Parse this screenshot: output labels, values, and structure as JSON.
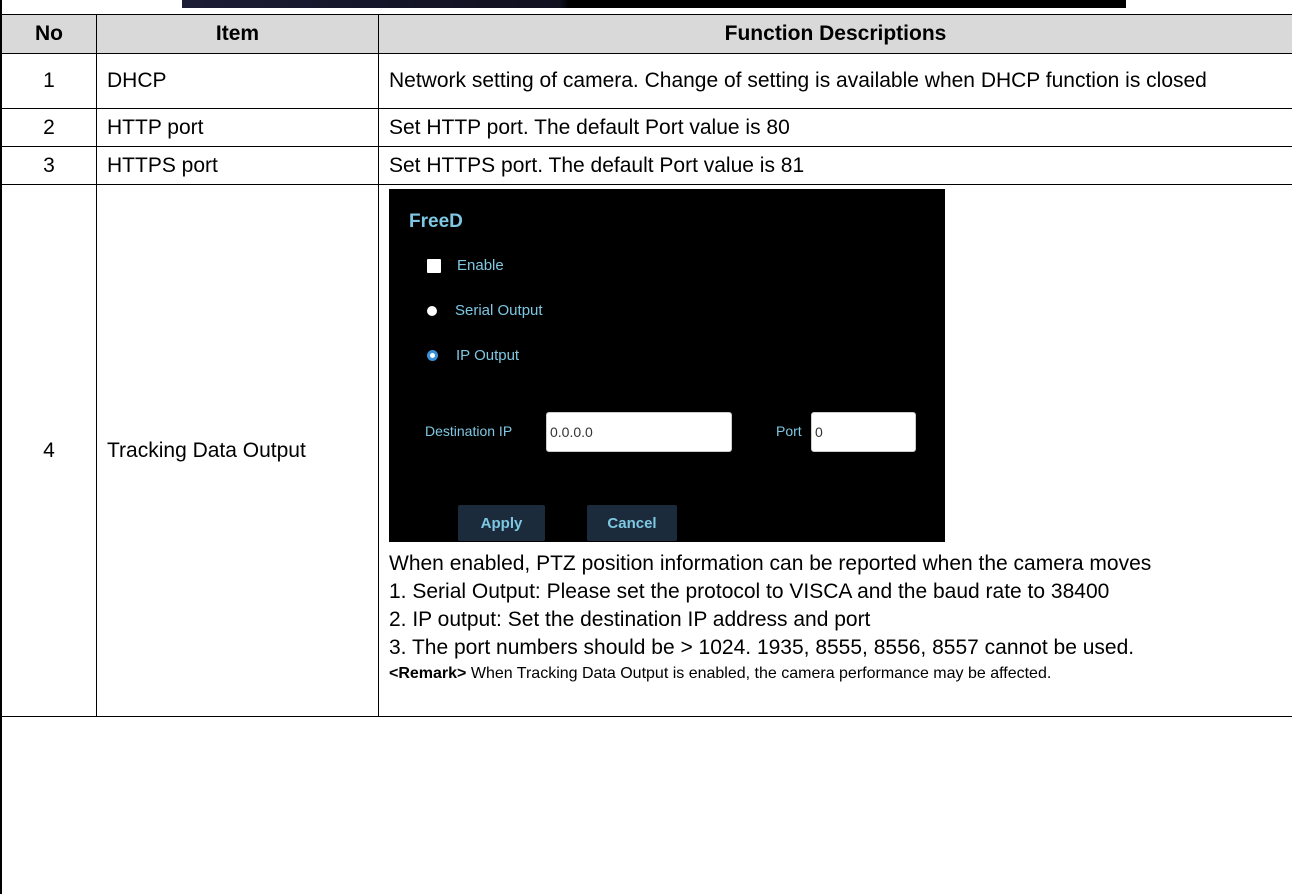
{
  "headers": {
    "no": "No",
    "item": "Item",
    "desc": "Function Descriptions"
  },
  "rows": [
    {
      "no": "1",
      "item": "DHCP",
      "desc": "Network setting of camera. Change of setting is available when DHCP function is closed"
    },
    {
      "no": "2",
      "item": "HTTP port",
      "desc": "Set HTTP port. The default Port value is 80"
    },
    {
      "no": "3",
      "item": "HTTPS port",
      "desc": "Set HTTPS port. The default Port value is 81"
    },
    {
      "no": "4",
      "item": "Tracking Data Output"
    }
  ],
  "freed": {
    "title": "FreeD",
    "enable_label": "Enable",
    "enable_checked": false,
    "serial_label": "Serial Output",
    "ip_label": "IP Output",
    "selected_output": "IP Output",
    "dest_ip_label": "Destination IP",
    "dest_ip_value": "0.0.0.0",
    "port_label": "Port",
    "port_value": "0",
    "apply_label": "Apply",
    "cancel_label": "Cancel",
    "accent_color": "#7ec8e3",
    "radio_selected_color": "#3a8fd8"
  },
  "tracking_desc": {
    "intro": "When enabled, PTZ position information can be reported when the camera moves",
    "items": [
      "1. Serial Output: Please set the protocol to VISCA and the baud rate to 38400",
      "2. IP output: Set the destination IP address and port",
      "3. The port numbers should be > 1024. 1935, 8555, 8556, 8557 cannot be used."
    ],
    "remark_tag": "<Remark>",
    "remark_text": " When Tracking Data Output is enabled, the camera performance may be affected."
  }
}
